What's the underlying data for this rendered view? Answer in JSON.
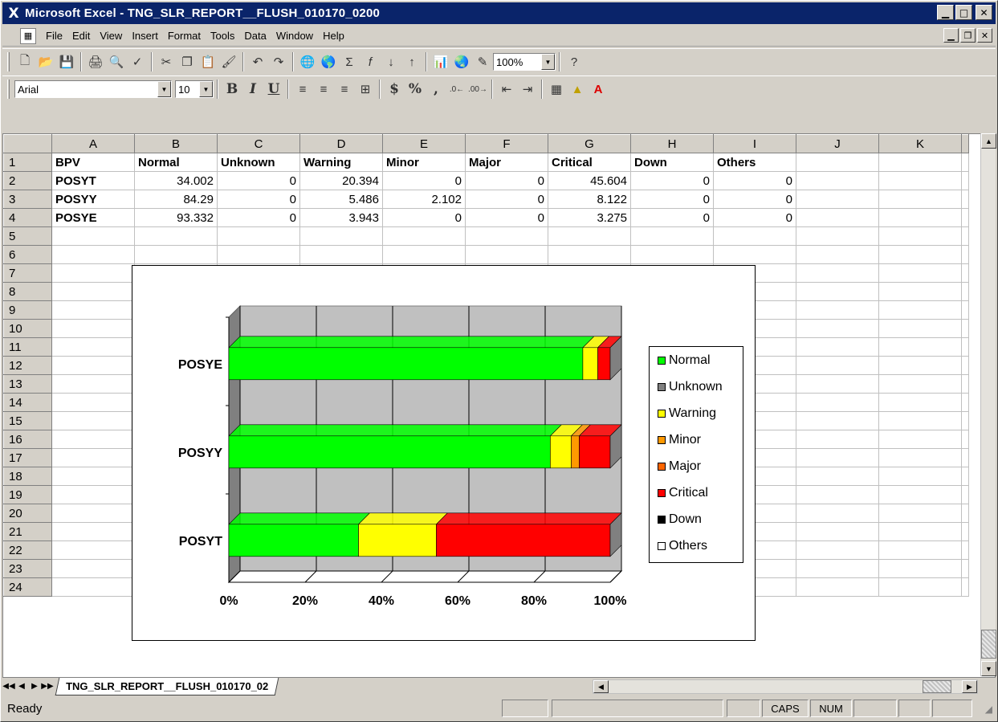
{
  "window": {
    "title": "Microsoft Excel - TNG_SLR_REPORT__FLUSH_010170_0200",
    "app_icon": "X"
  },
  "menu": {
    "items": [
      {
        "label": "File",
        "mnemonic": "F"
      },
      {
        "label": "Edit",
        "mnemonic": "E"
      },
      {
        "label": "View",
        "mnemonic": "V"
      },
      {
        "label": "Insert",
        "mnemonic": "I"
      },
      {
        "label": "Format",
        "mnemonic": "o"
      },
      {
        "label": "Tools",
        "mnemonic": "T"
      },
      {
        "label": "Data",
        "mnemonic": "D"
      },
      {
        "label": "Window",
        "mnemonic": "W"
      },
      {
        "label": "Help",
        "mnemonic": "H"
      }
    ]
  },
  "toolbar": {
    "zoom": "100%",
    "font_name": "Arial",
    "font_size": "10",
    "bold_label": "B",
    "italic_label": "I",
    "underline_label": "U",
    "currency_label": "$",
    "percent_label": "%",
    "comma_label": ","
  },
  "sheet": {
    "columns": [
      "A",
      "B",
      "C",
      "D",
      "E",
      "F",
      "G",
      "H",
      "I",
      "J",
      "K"
    ],
    "rows": [
      "1",
      "2",
      "3",
      "4",
      "5",
      "6",
      "7",
      "8",
      "9",
      "10",
      "11",
      "12",
      "13",
      "14",
      "15",
      "16",
      "17",
      "18",
      "19",
      "20",
      "21",
      "22",
      "23",
      "24"
    ],
    "header_row": [
      "BPV",
      "Normal",
      "Unknown",
      "Warning",
      "Minor",
      "Major",
      "Critical",
      "Down",
      "Others"
    ],
    "data_rows": [
      [
        "POSYT",
        "34.002",
        "0",
        "20.394",
        "0",
        "0",
        "45.604",
        "0",
        "0"
      ],
      [
        "POSYY",
        "84.29",
        "0",
        "5.486",
        "2.102",
        "0",
        "8.122",
        "0",
        "0"
      ],
      [
        "POSYE",
        "93.332",
        "0",
        "3.943",
        "0",
        "0",
        "3.275",
        "0",
        "0"
      ]
    ],
    "tab_name": "TNG_SLR_REPORT__FLUSH_010170_02"
  },
  "status": {
    "ready": "Ready",
    "caps": "CAPS",
    "num": "NUM"
  },
  "chart_data": {
    "type": "bar",
    "orientation": "horizontal",
    "stacked": "100%",
    "three_d": true,
    "categories": [
      "POSYE",
      "POSYY",
      "POSYT"
    ],
    "x_ticks": [
      "0%",
      "20%",
      "40%",
      "60%",
      "80%",
      "100%"
    ],
    "xlim": [
      0,
      100
    ],
    "legend_position": "right",
    "series": [
      {
        "name": "Normal",
        "color": "#00ff00",
        "values": [
          93.332,
          84.29,
          34.002
        ]
      },
      {
        "name": "Unknown",
        "color": "#808080",
        "values": [
          0,
          0,
          0
        ]
      },
      {
        "name": "Warning",
        "color": "#ffff00",
        "values": [
          3.943,
          5.486,
          20.394
        ]
      },
      {
        "name": "Minor",
        "color": "#ff9900",
        "values": [
          0,
          2.102,
          0
        ]
      },
      {
        "name": "Major",
        "color": "#ff6600",
        "values": [
          0,
          0,
          0
        ]
      },
      {
        "name": "Critical",
        "color": "#ff0000",
        "values": [
          3.275,
          8.122,
          45.604
        ]
      },
      {
        "name": "Down",
        "color": "#000000",
        "values": [
          0,
          0,
          0
        ]
      },
      {
        "name": "Others",
        "color": "#ffffff",
        "values": [
          0,
          0,
          0
        ]
      }
    ]
  }
}
